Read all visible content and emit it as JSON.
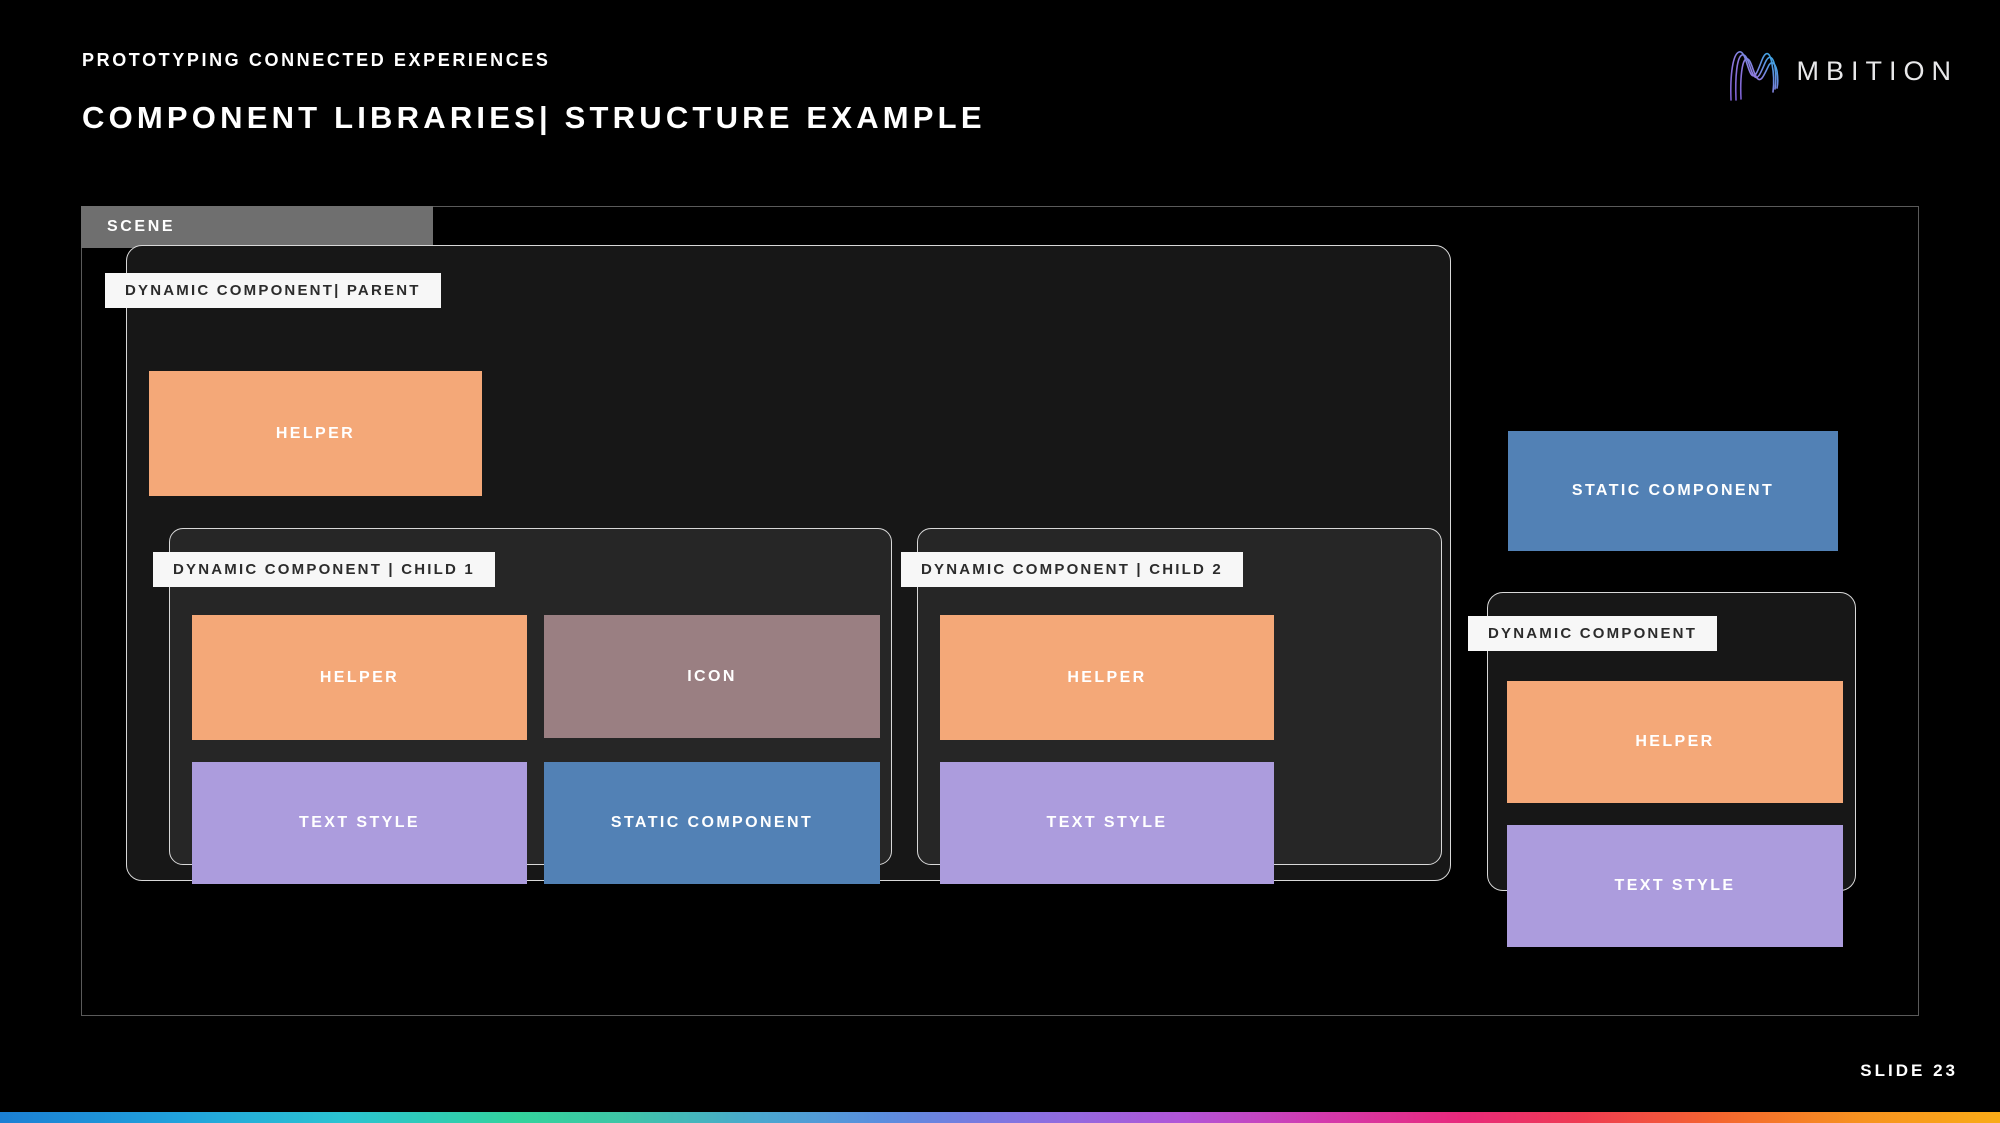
{
  "header": {
    "eyebrow": "PROTOTYPING CONNECTED EXPERIENCES",
    "title": "COMPONENT LIBRARIES| STRUCTURE EXAMPLE"
  },
  "logo": {
    "wordmark": "MBITION",
    "mark_name": "mbition-wave-mark",
    "gradient_start": "#8b6fd6",
    "gradient_end": "#35a8e0"
  },
  "scene": {
    "tag": "SCENE",
    "tag_bg": "#6f6f6f"
  },
  "parent": {
    "tag": "DYNAMIC COMPONENT| PARENT",
    "helper": {
      "label": "HELPER",
      "color": "#f4a878"
    }
  },
  "child1": {
    "tag": "DYNAMIC COMPONENT | CHILD 1",
    "cells": [
      {
        "label": "HELPER",
        "color": "#f4a878"
      },
      {
        "label": "ICON",
        "color": "#9a7f82"
      },
      {
        "label": "TEXT STYLE",
        "color": "#ac9cdd"
      },
      {
        "label": "STATIC COMPONENT",
        "color": "#5281b5"
      }
    ]
  },
  "child2": {
    "tag": "DYNAMIC COMPONENT | CHILD 2",
    "cells": [
      {
        "label": "HELPER",
        "color": "#f4a878"
      },
      {
        "label": "TEXT STYLE",
        "color": "#ac9cdd"
      }
    ]
  },
  "right_column": {
    "static_component": {
      "label": "STATIC COMPONENT",
      "color": "#5281b5"
    },
    "dynamic_component": {
      "tag": "DYNAMIC COMPONENT",
      "cells": [
        {
          "label": "HELPER",
          "color": "#f4a878"
        },
        {
          "label": "TEXT STYLE",
          "color": "#ac9cdd"
        }
      ]
    }
  },
  "footer": {
    "slide_number": "SLIDE 23"
  }
}
